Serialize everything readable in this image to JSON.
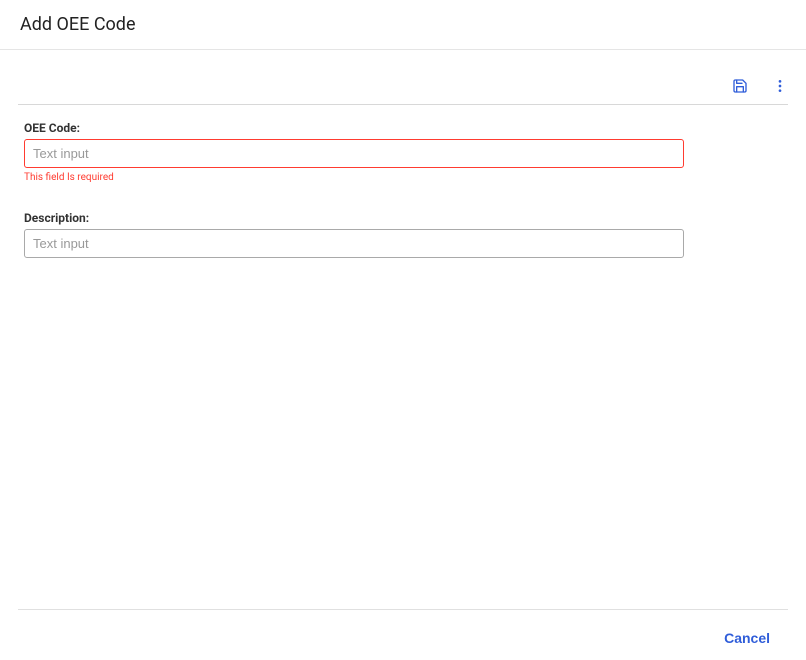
{
  "header": {
    "title": "Add OEE Code"
  },
  "toolbar": {
    "save_icon": "save-icon",
    "more_icon": "more-vertical-icon"
  },
  "form": {
    "oee_code": {
      "label": "OEE Code:",
      "value": "",
      "placeholder": "Text input",
      "error": "This field Is required"
    },
    "description": {
      "label": "Description:",
      "value": "",
      "placeholder": "Text input"
    }
  },
  "footer": {
    "cancel_label": "Cancel"
  },
  "colors": {
    "accent": "#2f5dd9",
    "error": "#ff3b30"
  }
}
